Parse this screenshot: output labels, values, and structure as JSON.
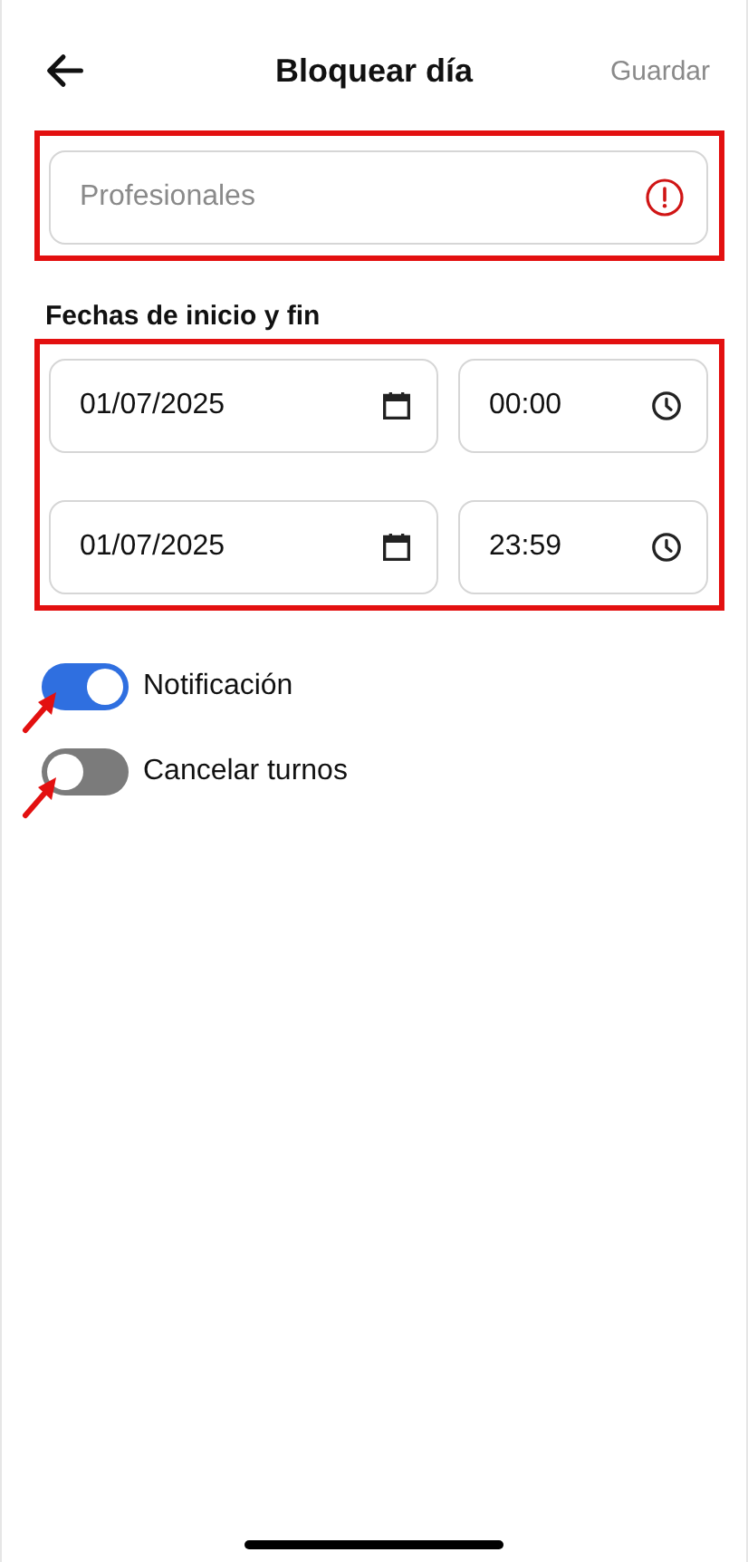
{
  "header": {
    "title": "Bloquear día",
    "action": "Guardar"
  },
  "professional_field": {
    "placeholder": "Profesionales",
    "error": true,
    "highlighted": true
  },
  "dates": {
    "label": "Fechas de inicio y fin",
    "highlighted": true,
    "rows": [
      {
        "date": "01/07/2025",
        "time": "00:00"
      },
      {
        "date": "01/07/2025",
        "time": "23:59"
      }
    ]
  },
  "toggles": [
    {
      "label": "Notificación",
      "on": true,
      "pointed": true
    },
    {
      "label": "Cancelar turnos",
      "on": false,
      "pointed": true
    }
  ]
}
